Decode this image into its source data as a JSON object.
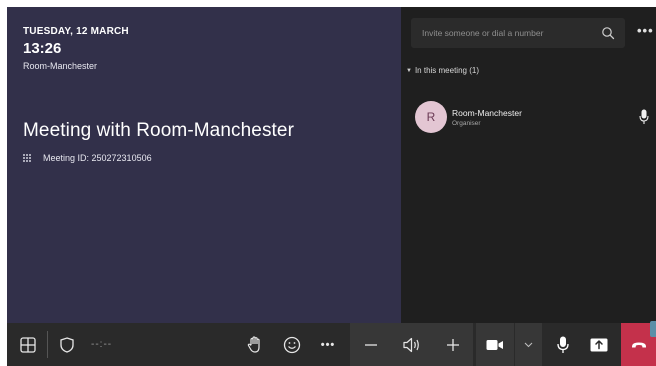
{
  "meeting": {
    "date": "TUESDAY, 12 MARCH",
    "time": "13:26",
    "room": "Room-Manchester",
    "title": "Meeting with Room-Manchester",
    "meeting_id": "Meeting ID: 250272310506"
  },
  "sidebar": {
    "search_placeholder": "Invite someone or dial a number",
    "more_label": "•••",
    "section_label": "In this meeting (1)",
    "participants": [
      {
        "initial": "R",
        "name": "Room-Manchester",
        "role": "Organiser"
      }
    ]
  },
  "toolbar": {
    "timer": "--:--",
    "more_label": "•••"
  },
  "colors": {
    "meeting_panel": "#32304a",
    "side_panel": "#1f1f1f",
    "toolbar": "#2a2a2a",
    "hangup": "#c4314b",
    "avatar": "#e3c6d3"
  },
  "icons": [
    "layout-icon",
    "shield-icon",
    "raise-hand-icon",
    "emoji-icon",
    "more-icon",
    "volume-down-icon",
    "speaker-icon",
    "volume-up-icon",
    "camera-icon",
    "chevron-down-icon",
    "mic-icon",
    "share-icon",
    "hang-up-icon",
    "search-icon",
    "dialpad-icon"
  ]
}
